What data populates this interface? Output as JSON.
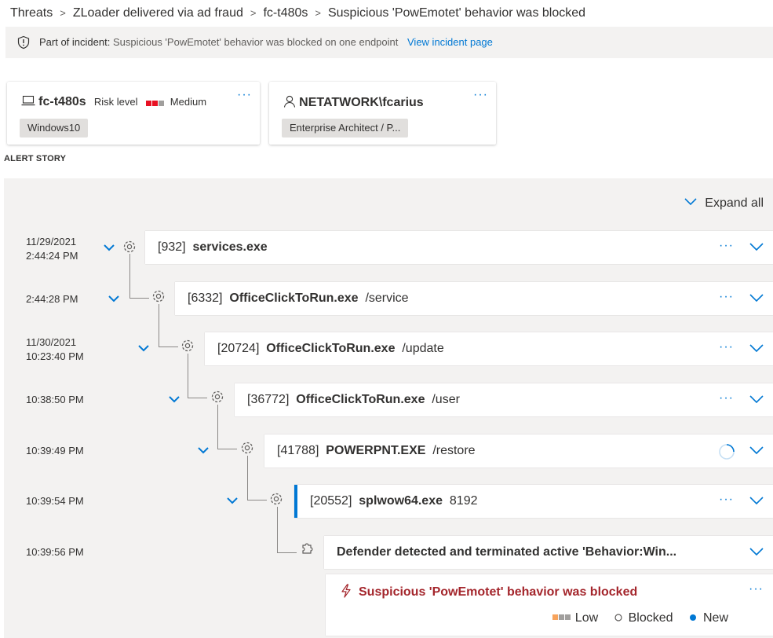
{
  "breadcrumb": {
    "items": [
      "Threats",
      "ZLoader delivered via ad fraud",
      "fc-t480s",
      "Suspicious 'PowEmotet' behavior was blocked"
    ]
  },
  "incident": {
    "label": "Part of incident:",
    "description": "Suspicious 'PowEmotet' behavior was blocked on one endpoint",
    "link": "View incident page"
  },
  "device_card": {
    "name": "fc-t480s",
    "risk_label": "Risk level",
    "risk_value": "Medium",
    "os": "Windows10",
    "more": "···"
  },
  "user_card": {
    "name": "NETATWORK\\fcarius",
    "title": "Enterprise Architect / P...",
    "more": "···"
  },
  "alert_story": {
    "label": "ALERT STORY",
    "expand_all": "Expand all",
    "nodes": [
      {
        "date": "11/29/2021",
        "time": "2:44:24 PM",
        "pid": "[932]",
        "name": "services.exe",
        "args": ""
      },
      {
        "date": "",
        "time": "2:44:28 PM",
        "pid": "[6332]",
        "name": "OfficeClickToRun.exe",
        "args": "/service"
      },
      {
        "date": "11/30/2021",
        "time": "10:23:40 PM",
        "pid": "[20724]",
        "name": "OfficeClickToRun.exe",
        "args": "/update"
      },
      {
        "date": "",
        "time": "10:38:50 PM",
        "pid": "[36772]",
        "name": "OfficeClickToRun.exe",
        "args": "/user"
      },
      {
        "date": "",
        "time": "10:39:49 PM",
        "pid": "[41788]",
        "name": "POWERPNT.EXE",
        "args": "/restore"
      },
      {
        "date": "",
        "time": "10:39:54 PM",
        "pid": "[20552]",
        "name": "splwow64.exe",
        "args": "8192"
      }
    ],
    "detection": {
      "time": "10:39:56 PM",
      "text": "Defender detected and terminated active 'Behavior:Win..."
    },
    "alert": {
      "title": "Suspicious 'PowEmotet' behavior was blocked",
      "severity": "Low",
      "status": "Blocked",
      "state": "New"
    }
  },
  "colors": {
    "accent": "#0078d4",
    "risk_medium": "#e81123",
    "severity_low": "#f7a35c",
    "alert_red": "#a4262c"
  }
}
